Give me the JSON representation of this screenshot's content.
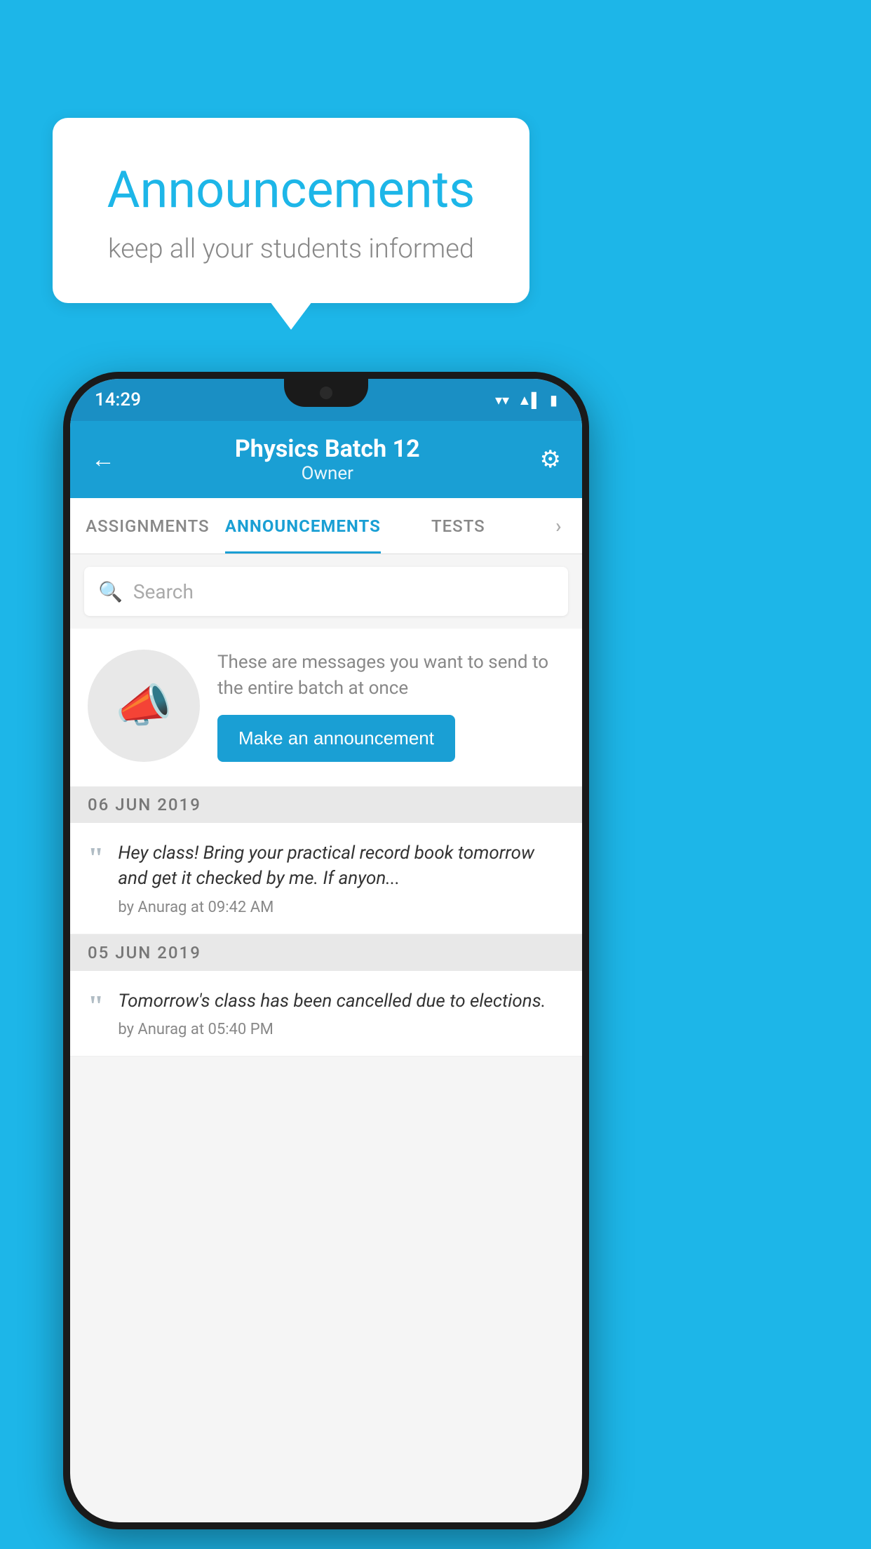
{
  "background_color": "#1db6e8",
  "speech_bubble": {
    "title": "Announcements",
    "subtitle": "keep all your students informed"
  },
  "phone": {
    "status_bar": {
      "time": "14:29",
      "wifi_icon": "▼",
      "signal_icon": "▲",
      "battery_icon": "▮"
    },
    "header": {
      "back_label": "←",
      "title": "Physics Batch 12",
      "subtitle": "Owner",
      "settings_icon": "⚙"
    },
    "tabs": [
      {
        "label": "ASSIGNMENTS",
        "active": false
      },
      {
        "label": "ANNOUNCEMENTS",
        "active": true
      },
      {
        "label": "TESTS",
        "active": false
      },
      {
        "label": "›",
        "active": false
      }
    ],
    "search": {
      "placeholder": "Search"
    },
    "promo": {
      "description": "These are messages you want to send to the entire batch at once",
      "button_label": "Make an announcement"
    },
    "announcements": [
      {
        "date": "06  JUN  2019",
        "message": "Hey class! Bring your practical record book tomorrow and get it checked by me. If anyon...",
        "meta": "by Anurag at 09:42 AM"
      },
      {
        "date": "05  JUN  2019",
        "message": "Tomorrow's class has been cancelled due to elections.",
        "meta": "by Anurag at 05:40 PM"
      }
    ]
  }
}
